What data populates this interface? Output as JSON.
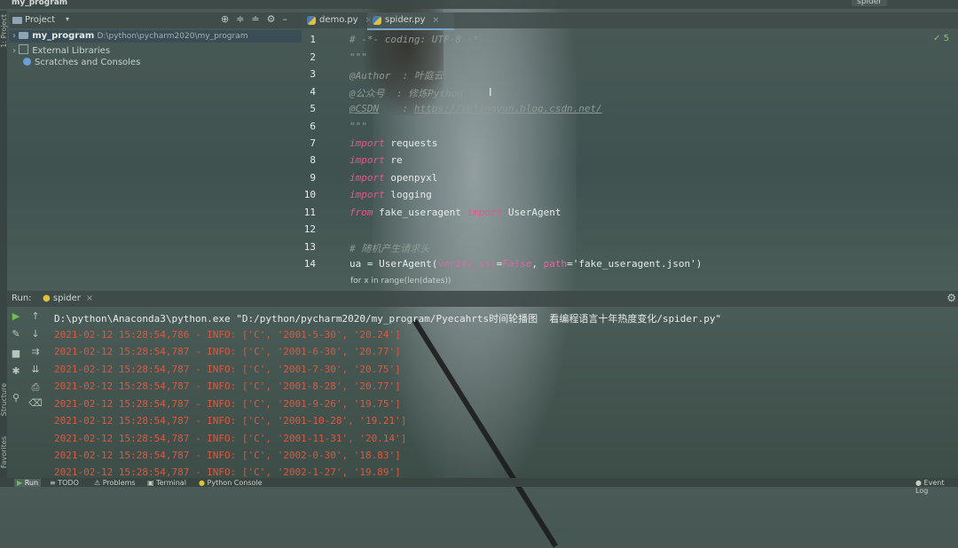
{
  "window": {
    "title": "my_program",
    "run_config": "spider"
  },
  "side_stripe": {
    "project": "1: Project",
    "structure": "Structure",
    "favorites": "Favorites"
  },
  "project_panel": {
    "header": "Project",
    "items": [
      {
        "name": "my_program",
        "path": "D:\\python\\pycharm2020\\my_program"
      },
      {
        "name": "External Libraries"
      },
      {
        "name": "Scratches and Consoles"
      }
    ]
  },
  "editor": {
    "tabs": [
      {
        "label": "demo.py",
        "active": false
      },
      {
        "label": "spider.py",
        "active": true
      }
    ],
    "line_numbers": [
      "1",
      "2",
      "3",
      "4",
      "5",
      "6",
      "7",
      "8",
      "9",
      "10",
      "11",
      "12",
      "13",
      "14"
    ],
    "lines": {
      "l1": "# -*- coding: UTF-8 -*-",
      "l2": "\"\"\"",
      "l3": "@Author  : 叶庭云",
      "l4": "@公众号  : 修炼Python",
      "l5_key": "@CSDN",
      "l5_rest": "    : ",
      "l5_url": "https://yetingyun.blog.csdn.net/",
      "l6": "\"\"\"",
      "kw_import": "import",
      "kw_from": "from",
      "l7_mod": "requests",
      "l8_mod": "re",
      "l9_mod": "openpyxl",
      "l10_mod": "logging",
      "l11_mod": "fake_useragent",
      "l11_cls": "UserAgent",
      "l13": "# 随机产生请求头",
      "l14_a": "ua",
      "l14_eq": " = ",
      "l14_cls": "UserAgent",
      "l14_p1": "verify_ssl",
      "l14_false": "False",
      "l14_p2": "path",
      "l14_str": "'fake_useragent.json'"
    },
    "inspection_count": "5",
    "breadcrumb_hint": "for x in range(len(dates))"
  },
  "run_panel": {
    "label": "Run:",
    "tab": "spider",
    "command": "D:\\python\\Anaconda3\\python.exe \"D:/python/pycharm2020/my_program/Pyecahrts时间轮播图  看编程语言十年热度变化/spider.py\"",
    "log_lines": [
      "2021-02-12 15:28:54,786 - INFO: ['C', '2001-5-30', '20.24']",
      "2021-02-12 15:28:54,787 - INFO: ['C', '2001-6-30', '20.77']",
      "2021-02-12 15:28:54,787 - INFO: ['C', '2001-7-30', '20.75']",
      "2021-02-12 15:28:54,787 - INFO: ['C', '2001-8-28', '20.77']",
      "2021-02-12 15:28:54,787 - INFO: ['C', '2001-9-26', '19.75']",
      "2021-02-12 15:28:54,787 - INFO: ['C', '2001-10-28', '19.21']",
      "2021-02-12 15:28:54,787 - INFO: ['C', '2001-11-31', '20.14']",
      "2021-02-12 15:28:54,787 - INFO: ['C', '2002-0-30', '18.83']",
      "2021-02-12 15:28:54,787 - INFO: ['C', '2002-1-27', '19.89']"
    ]
  },
  "bottom_bar": {
    "run": "Run",
    "todo": "TODO",
    "problems": "Problems",
    "terminal": "Terminal",
    "python_console": "Python Console",
    "event_log": "Event Log"
  },
  "colors": {
    "keyword": "#e05a8c",
    "log_text": "#e0563f",
    "comment": "#8f9a95"
  }
}
